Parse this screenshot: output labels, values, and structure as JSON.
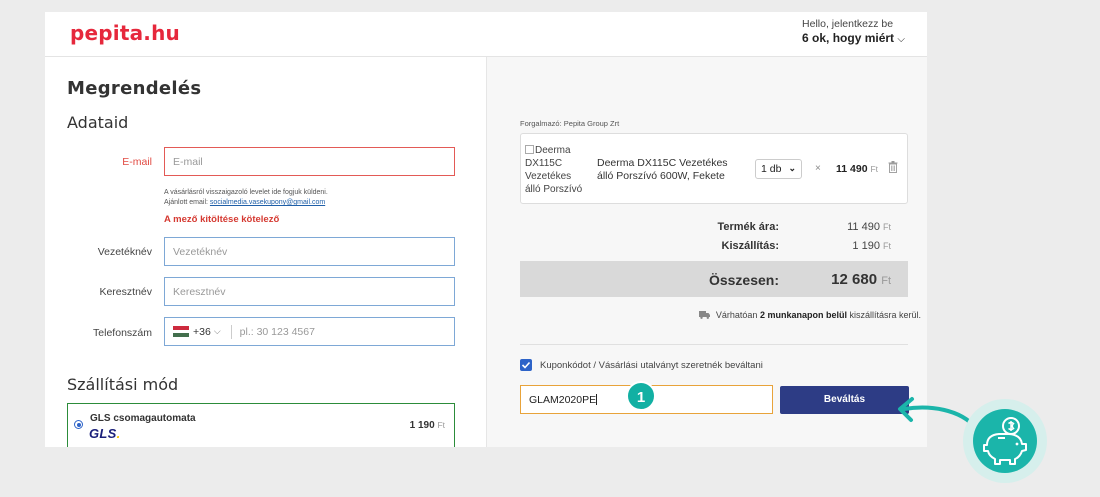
{
  "header": {
    "logo": "pepita.hu",
    "hello_line1": "Hello, jelentkezz be",
    "hello_line2": "6 ok, hogy miért",
    "hello_chevron": "⌵"
  },
  "form": {
    "title": "Megrendelés",
    "section_personal": "Adataid",
    "email": {
      "label": "E-mail",
      "placeholder": "E-mail",
      "help1": "A vásárlásról visszaigazoló levelet ide fogjuk küldeni.",
      "help2_prefix": "Ajánlott email: ",
      "help2_email": "socialmedia.vasekupony@gmail.com",
      "error": "A mező kitöltése kötelező"
    },
    "lastname": {
      "label": "Vezetéknév",
      "placeholder": "Vezetéknév"
    },
    "firstname": {
      "label": "Keresztnév",
      "placeholder": "Keresztnév"
    },
    "phone": {
      "label": "Telefonszám",
      "country_code": "+36",
      "chevron": "⌵",
      "placeholder": "pl.: 30 123 4567"
    },
    "section_shipping": "Szállítási mód",
    "shipping_option": {
      "name": "GLS csomagautomata",
      "logo_text": "GLS",
      "logo_dot": ".",
      "price": "1 190",
      "currency": "Ft"
    }
  },
  "cart": {
    "seller": "Forgalmazó: Pepita Group Zrt",
    "product": {
      "image_alt": "Deerma DX115C Vezetékes álló Porszívó",
      "name": "Deerma DX115C Vezetékes álló Porszívó 600W, Fekete",
      "quantity": "1 db",
      "quantity_chevron": "⌄",
      "times": "×",
      "price": "11 490",
      "currency": "Ft"
    },
    "product_price_label": "Termék ára:",
    "product_price_value": "11 490",
    "shipping_label": "Kiszállítás:",
    "shipping_value": "1 190",
    "total_label": "Összesen:",
    "total_value": "12 680",
    "currency": "Ft",
    "delivery_prefix": "Várhatóan ",
    "delivery_bold": "2 munkanapon belül",
    "delivery_suffix": " kiszállításra kerül.",
    "coupon_checkbox_label": "Kuponkódot / Vásárlási utalványt szeretnék beváltani",
    "coupon_value": "GLAM2020PE",
    "redeem_button": "Beváltás"
  },
  "overlay": {
    "step_number": "1"
  },
  "colors": {
    "brand_red": "#e6283c",
    "primary_blue": "#2d3c85",
    "teal": "#1bb5aa",
    "error_red": "#d53a32",
    "focus_orange": "#e8a33a"
  }
}
